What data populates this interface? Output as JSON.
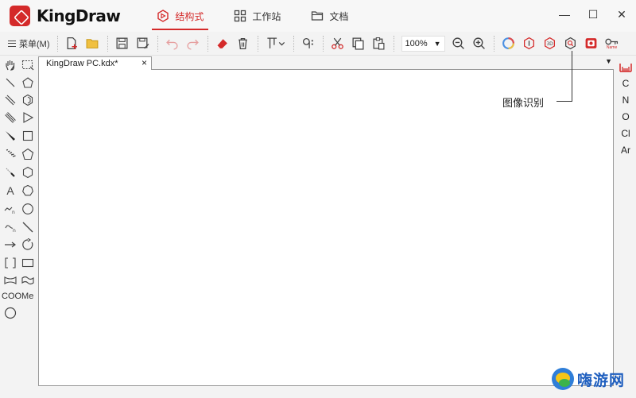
{
  "app": {
    "name": "KingDraw",
    "accent": "#d42a2a"
  },
  "top_tabs": [
    {
      "label": "结构式",
      "icon": "hexagon-structure-icon",
      "active": true
    },
    {
      "label": "工作站",
      "icon": "grid-workstation-icon",
      "active": false
    },
    {
      "label": "文档",
      "icon": "folder-icon",
      "active": false
    }
  ],
  "window_controls": {
    "minimize": "—",
    "maximize": "☐",
    "close": "✕"
  },
  "toolbar": {
    "menu_label": "菜单(M)",
    "zoom_value": "100%",
    "name_icon_caption": "Name"
  },
  "document": {
    "tab_title": "KingDraw PC.kdx*",
    "close_glyph": "×",
    "dropdown_glyph": "▼"
  },
  "left_tools": {
    "text_tool": "A",
    "ester_group": "COOMe",
    "subscript_n": "n"
  },
  "right_elements": [
    "C",
    "N",
    "O",
    "Cl",
    "Ar"
  ],
  "callout": {
    "label": "图像识别"
  },
  "watermark": {
    "text": "嗨游网"
  }
}
